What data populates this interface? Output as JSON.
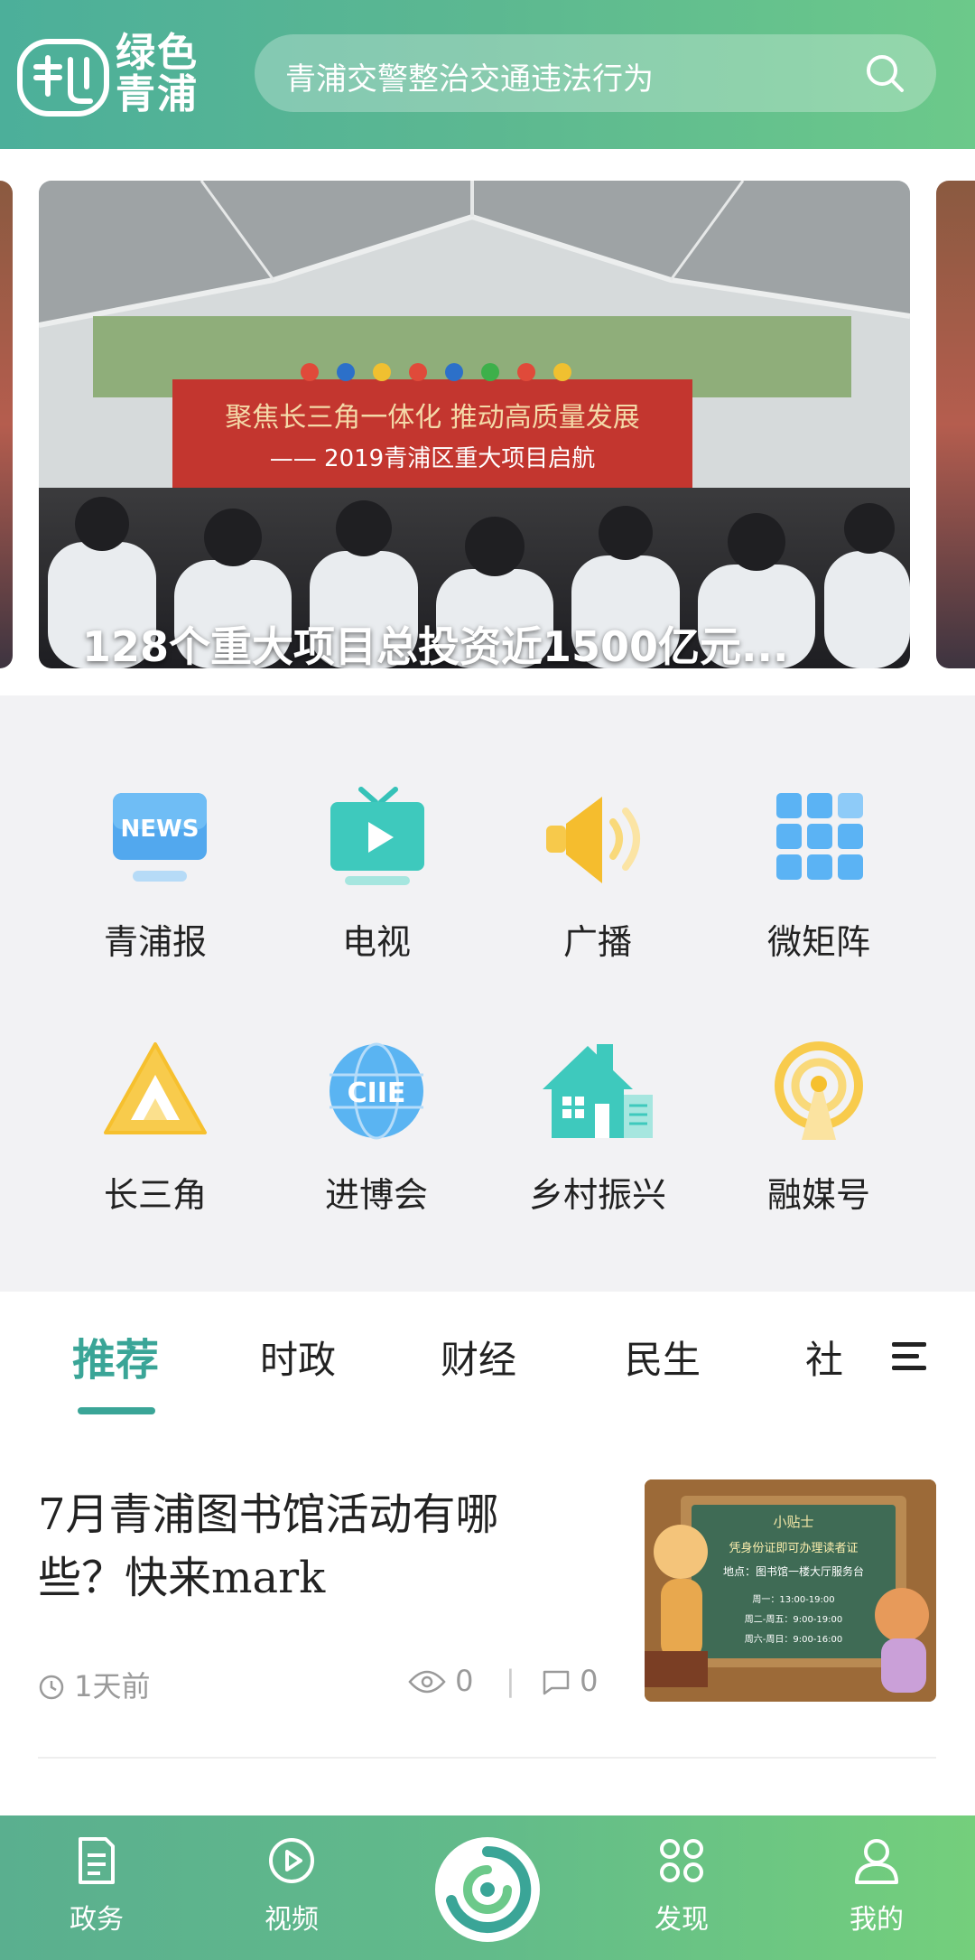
{
  "header": {
    "logo_text": "绿色青浦",
    "search_placeholder": "青浦交警整治交通违法行为"
  },
  "carousel": {
    "caption": "128个重大项目总投资近1500亿元...",
    "banner_line1": "聚焦长三角一体化  推动高质量发展",
    "banner_line2": "—— 2019青浦区重大项目启航"
  },
  "shortcuts": [
    {
      "label": "青浦报",
      "icon": "news-icon"
    },
    {
      "label": "电视",
      "icon": "tv-icon"
    },
    {
      "label": "广播",
      "icon": "speaker-icon"
    },
    {
      "label": "微矩阵",
      "icon": "grid-apps-icon"
    },
    {
      "label": "长三角",
      "icon": "triangle-icon"
    },
    {
      "label": "进博会",
      "icon": "ciie-globe-icon"
    },
    {
      "label": "乡村振兴",
      "icon": "village-house-icon"
    },
    {
      "label": "融媒号",
      "icon": "broadcast-tower-icon"
    }
  ],
  "news_icon_text": "NEWS",
  "ciie_icon_text": "CIIE",
  "tabs": [
    {
      "label": "推荐",
      "active": true
    },
    {
      "label": "时政",
      "active": false
    },
    {
      "label": "财经",
      "active": false
    },
    {
      "label": "民生",
      "active": false
    },
    {
      "label": "社",
      "active": false
    }
  ],
  "article": {
    "title": "7月青浦图书馆活动有哪些？快来mark",
    "time": "1天前",
    "views": "0",
    "comments": "0",
    "thumb_board_title": "小贴士",
    "thumb_board_lines": [
      "凭身份证即可办理读者证",
      "地点：图书馆一楼大厅服务台",
      "周一：13:00-19:00",
      "周二-周五：9:00-19:00",
      "周六-周日：9:00-16:00"
    ]
  },
  "bottom_nav": [
    {
      "label": "政务",
      "icon": "document-icon"
    },
    {
      "label": "视频",
      "icon": "play-circle-icon"
    },
    {
      "label": "",
      "icon": "home-logo-icon"
    },
    {
      "label": "发现",
      "icon": "discover-icon"
    },
    {
      "label": "我的",
      "icon": "profile-icon"
    }
  ],
  "colors": {
    "accent": "#3aa597",
    "header_start": "#4caf9a",
    "header_end": "#6cc98a"
  }
}
